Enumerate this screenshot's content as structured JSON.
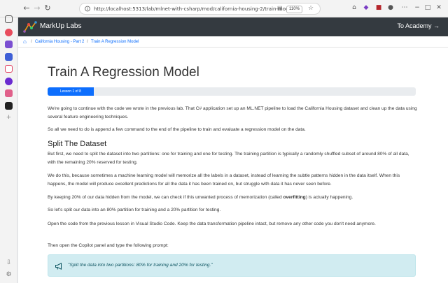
{
  "browser": {
    "url": "http://localhost:5313/lab/mlnet-with-csharp/mod/california-housing-2/train-model/",
    "zoom": "110%"
  },
  "app": {
    "brand": "MarkUp Labs",
    "to_academy": "To Academy →"
  },
  "breadcrumb": {
    "items": [
      "California Housing - Part 2",
      "Train A Regression Model"
    ]
  },
  "lesson": {
    "title": "Train A Regression Model",
    "progress_label": "Lesson 1 of 8",
    "progress_fraction": 0.125
  },
  "content": {
    "p1": "We're going to continue with the code we wrote in the previous lab. That C# application set up an ML.NET pipeline to load the California Housing dataset and clean up the data using several feature engineering techniques.",
    "p2": "So all we need to do is append a few command to the end of the pipeline to train and evaluate a regression model on the data.",
    "h2": "Split The Dataset",
    "p3": "But first, we need to split the dataset into two partitions: one for training and one for testing. The training partition is typically a randomly shuffled subset of around 80% of all data, with the remaining 20% reserved for testing.",
    "p4": "We do this, because sometimes a machine learning model will memorize all the labels in a dataset, instead of learning the subtle patterns hidden in the data itself. When this happens, the model will produce excellent predictions for all the data it has been trained on, but struggle with data it has never seen before.",
    "p5_a": "By keeping 20% of our data hidden from the model, we can check if this unwanted process of memorization (called ",
    "p5_b": "overfitting",
    "p5_c": ") is actually happening.",
    "p6": "So let's split our data into an 80% partition for training and a 20% partition for testing.",
    "p7": "Open the code from the previous lesson in Visual Studio Code. Keep the data transformation pipeline intact, but remove any other code you don't need anymore.",
    "p8": "Then open the Copilot panel and type the following prompt:",
    "prompt": "\"Split the data into two partitions: 80% for training and 20% for testing.\""
  },
  "colors": {
    "navbar": "#343a40",
    "accent": "#0d6efd",
    "callout_bg": "#d1ecf1"
  }
}
